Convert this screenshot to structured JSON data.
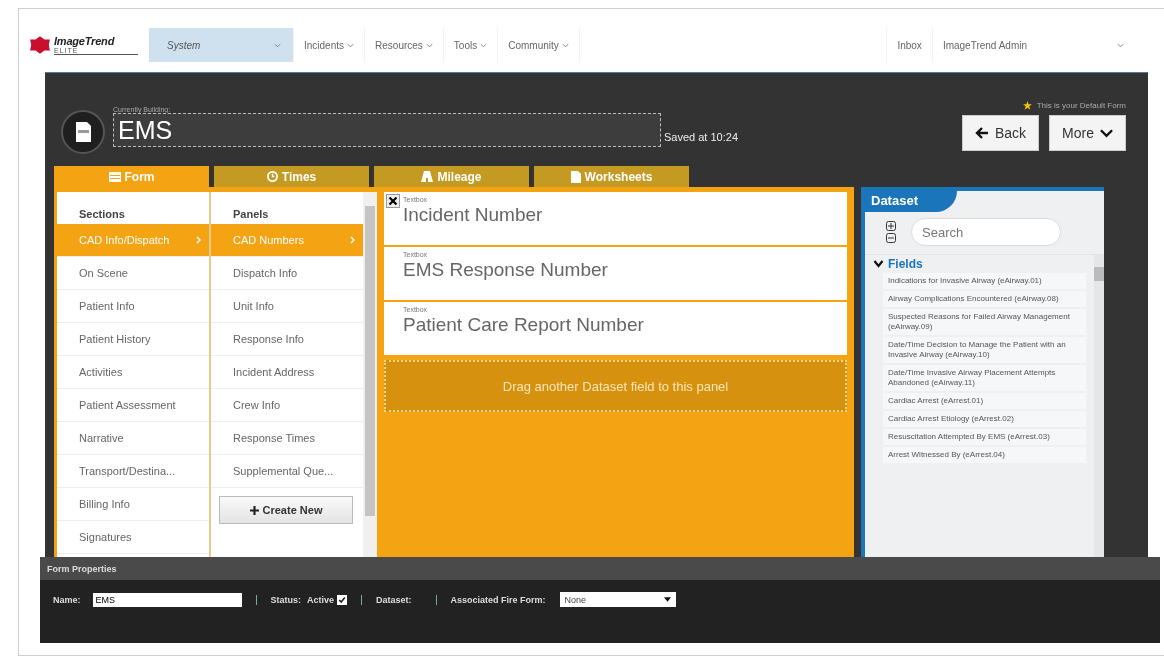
{
  "nav": {
    "logo": {
      "name": "ImageTrend",
      "sub": "ELITE"
    },
    "items": [
      {
        "label": "System",
        "selected": true
      },
      {
        "label": "Incidents",
        "selected": false
      },
      {
        "label": "Resources",
        "selected": false
      },
      {
        "label": "Tools",
        "selected": false
      },
      {
        "label": "Community",
        "selected": false
      }
    ],
    "right": [
      {
        "label": "Inbox"
      },
      {
        "label": "ImageTrend Admin"
      }
    ]
  },
  "header": {
    "caption": "Currently Building:",
    "title": "EMS",
    "saved": "Saved at 10:24",
    "default_note": "This is your Default Form",
    "buttons": [
      {
        "label": "Back",
        "kind": "back"
      },
      {
        "label": "More",
        "kind": "more"
      }
    ]
  },
  "tabs": [
    {
      "label": "Form",
      "kind": "form",
      "selected": true
    },
    {
      "label": "Times",
      "kind": "times",
      "selected": false
    },
    {
      "label": "Mileage",
      "kind": "mileage",
      "selected": false
    },
    {
      "label": "Worksheets",
      "kind": "worksheets",
      "selected": false
    }
  ],
  "sections": {
    "heading": "Sections",
    "items": [
      {
        "label": "CAD Info/Dispatch",
        "selected": true
      },
      {
        "label": "On Scene",
        "selected": false
      },
      {
        "label": "Patient Info",
        "selected": false
      },
      {
        "label": "Patient History",
        "selected": false
      },
      {
        "label": "Activities",
        "selected": false
      },
      {
        "label": "Patient Assessment",
        "selected": false
      },
      {
        "label": "Narrative",
        "selected": false
      },
      {
        "label": "Transport/Destina...",
        "selected": false
      },
      {
        "label": "Billing Info",
        "selected": false
      },
      {
        "label": "Signatures",
        "selected": false
      }
    ]
  },
  "panels": {
    "heading": "Panels",
    "items": [
      {
        "label": "CAD Numbers",
        "selected": true
      },
      {
        "label": "Dispatch Info",
        "selected": false
      },
      {
        "label": "Unit Info",
        "selected": false
      },
      {
        "label": "Response Info",
        "selected": false
      },
      {
        "label": "Incident Address",
        "selected": false
      },
      {
        "label": "Crew Info",
        "selected": false
      },
      {
        "label": "Response Times",
        "selected": false
      },
      {
        "label": "Supplemental Que...",
        "selected": false
      }
    ],
    "create_button": "Create New"
  },
  "fields": [
    {
      "type": "Textbox",
      "label": "Incident Number",
      "removable": true
    },
    {
      "type": "Textbox",
      "label": "EMS Response Number",
      "removable": false
    },
    {
      "type": "Textbox",
      "label": "Patient Care Report Number",
      "removable": false
    }
  ],
  "drop_zone": "Drag another Dataset field to this panel",
  "dataset": {
    "title": "Dataset",
    "search_placeholder": "Search",
    "group": {
      "label": "Fields",
      "expanded": true
    },
    "items": [
      "Indications for Invasive Airway (eAirway.01)",
      "Airway Complications Encountered (eAirway.08)",
      "Suspected Reasons for Failed Airway Management (eAirway.09)",
      "Date/Time Decision to Manage the Patient with an Invasive Airway (eAirway.10)",
      "Date/Time Invasive Airway Placement Attempts Abandoned (eAirway.11)",
      "Cardiac Arrest (eArrest.01)",
      "Cardiac Arrest Etiology (eArrest.02)",
      "Resuscitation Attempted By EMS (eArrest.03)",
      "Arrest Witnessed By (eArrest.04)"
    ]
  },
  "form_properties": {
    "title": "Form Properties",
    "name_label": "Name:",
    "name_value": "EMS",
    "status_label": "Status:",
    "status_value": "Active",
    "active_checked": true,
    "dataset_label": "Dataset:",
    "fire_form_label": "Associated Fire Form:",
    "fire_form_value": "None"
  }
}
